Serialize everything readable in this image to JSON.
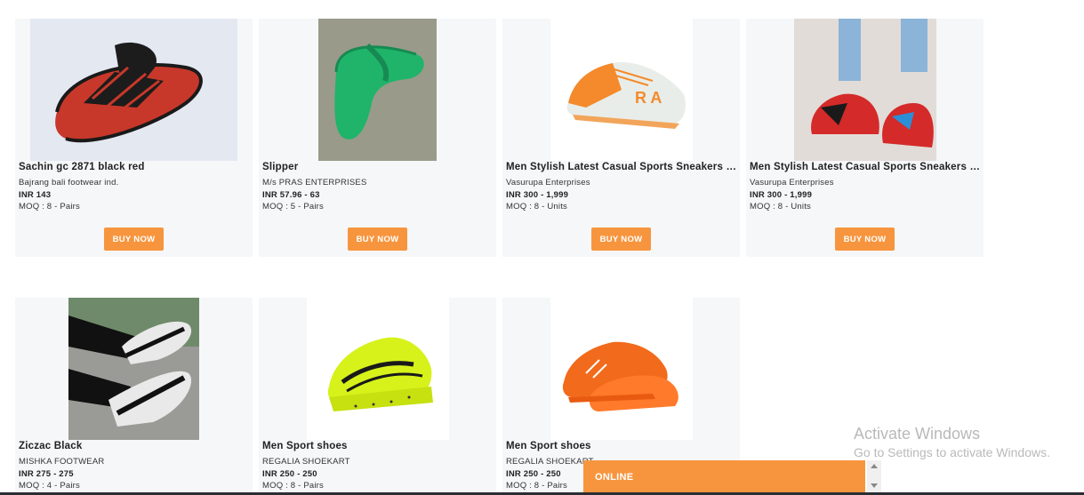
{
  "products": [
    {
      "title": "Sachin gc 2871 black red",
      "seller": "Bajrang bali footwear ind.",
      "price": "INR 143",
      "moq": "MOQ : 8 - Pairs",
      "buy_label": "BUY NOW"
    },
    {
      "title": "Slipper",
      "seller": "M/s PRAS ENTERPRISES",
      "price": "INR 57.96 - 63",
      "moq": "MOQ : 5 - Pairs",
      "buy_label": "BUY NOW"
    },
    {
      "title": "Men Stylish Latest Casual Sports Sneakers Sh...",
      "seller": "Vasurupa Enterprises",
      "price": "INR 300 - 1,999",
      "moq": "MOQ : 8 - Units",
      "buy_label": "BUY NOW"
    },
    {
      "title": "Men Stylish Latest Casual Sports Sneakers Sh...",
      "seller": "Vasurupa Enterprises",
      "price": "INR 300 - 1,999",
      "moq": "MOQ : 8 - Units",
      "buy_label": "BUY NOW"
    },
    {
      "title": "Ziczac Black",
      "seller": "MISHKA FOOTWEAR",
      "price": "INR 275 - 275",
      "moq": "MOQ : 4 - Pairs"
    },
    {
      "title": "Men Sport shoes",
      "seller": "REGALIA SHOEKART",
      "price": "INR 250 - 250",
      "moq": "MOQ : 8 - Pairs"
    },
    {
      "title": "Men Sport shoes",
      "seller": "REGALIA SHOEKART",
      "price": "INR 250 - 250",
      "moq": "MOQ : 8 - Pairs"
    }
  ],
  "chat": {
    "label": "ONLINE"
  },
  "watermark": {
    "line1": "Activate Windows",
    "line2": "Go to Settings to activate Windows."
  },
  "colors": {
    "accent": "#f7953e",
    "card_bg": "#f5f7f9"
  }
}
